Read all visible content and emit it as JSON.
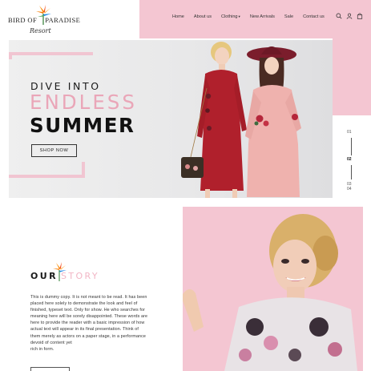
{
  "brand": {
    "name_top_left": "BIRD OF",
    "name_top_right": "PARADISE",
    "script": "Resort"
  },
  "nav": {
    "items": [
      "Home",
      "About us",
      "Clothing",
      "New Arrivals",
      "Sale",
      "Contact us"
    ],
    "dropdown_item_index": 2,
    "icons": [
      "search-icon",
      "user-icon",
      "bag-icon"
    ]
  },
  "hero": {
    "line1": "DIVE INTO",
    "line2": "ENDLESS",
    "line3": "SUMMER",
    "cta": "SHOP NOW",
    "slides": {
      "prev": "01",
      "current": "02",
      "next_a": "03",
      "next_b": "04"
    }
  },
  "story": {
    "title_dark": "OUR",
    "title_pink": "STORY",
    "lines": [
      "This is dummy copy. It is not meant to be read. It has been",
      "placed here solely to demonstrate the look and feel of",
      "finished, typeset text. Only for show. He who searches for",
      "meaning here will be sorely disappointed. These words are",
      "here to provide the reader with a basic impression of how",
      "actual text will appear in its final presentation. Think of",
      "them merely as actors on a paper stage, in a performance",
      "devoid of content yet",
      "rich in form."
    ]
  },
  "colors": {
    "accent_pink": "#f4c6d2",
    "title_pink": "#eaa6b8",
    "dark_text": "#1a1a1a"
  }
}
